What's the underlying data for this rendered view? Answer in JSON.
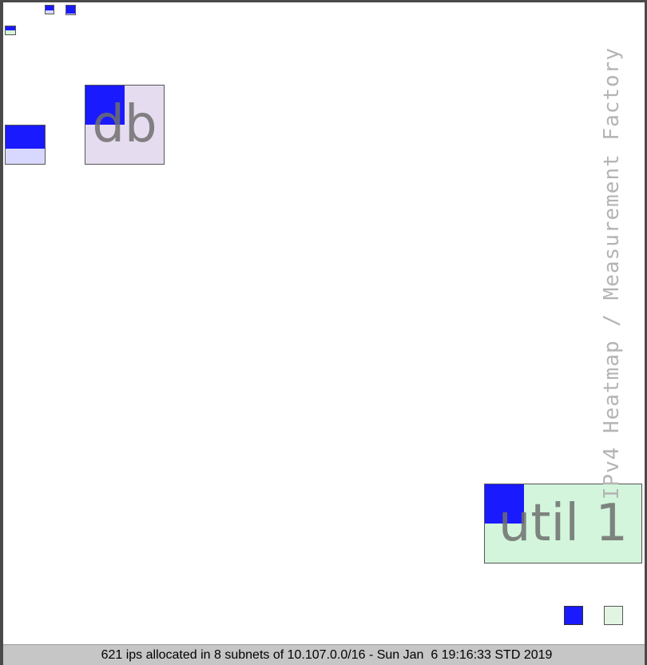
{
  "chart_data": {
    "type": "heatmap",
    "title": "IPv4 Heatmap / Measurement Factory",
    "subnets": [
      {
        "label": "",
        "allocated_fraction": 0.6,
        "fill_color": "#1a1aff",
        "bg_color": "#d8d8ff"
      },
      {
        "label": "",
        "allocated_fraction": 0.9,
        "fill_color": "#1a1aff",
        "bg_color": "#d8d8ff"
      },
      {
        "label": "",
        "allocated_fraction": 0.5,
        "fill_color": "#1a1aff",
        "bg_color": "#d8f5d8"
      },
      {
        "label": "",
        "allocated_fraction": 0.6,
        "fill_color": "#1a1aff",
        "bg_color": "#d8d8ff"
      },
      {
        "label": "db",
        "allocated_fraction": 0.25,
        "fill_color": "#1a1aff",
        "bg_color": "#e6dcef"
      },
      {
        "label": "util 1",
        "allocated_fraction": 0.25,
        "fill_color": "#1a1aff",
        "bg_color": "#d2f5dc"
      }
    ],
    "legend": [
      {
        "color": "#1a1aff"
      },
      {
        "color": "#e2f5e2"
      }
    ]
  },
  "status": {
    "text": "621 ips allocated in 8 subnets of 10.107.0.0/16 - Sun Jan  6 19:16:33 STD 2019"
  }
}
